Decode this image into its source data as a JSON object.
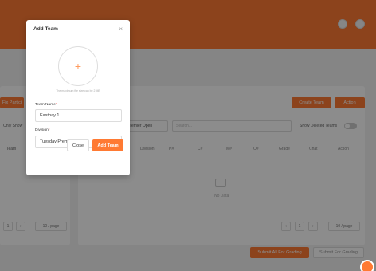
{
  "modal": {
    "title": "Add Team",
    "close_glyph": "×",
    "upload_plus": "+",
    "upload_hint": "The maximum file size can be 2 MB",
    "team_name_label": "Team Name",
    "team_name_value": "Eastbay 1",
    "division_label": "Division",
    "division_value": "Tuesday Premier Open",
    "required_mark": "*",
    "close_button": "Close",
    "add_button": "Add Team"
  },
  "background": {
    "left_button": "Fix Partici",
    "left_only_show": "Only Show",
    "left_team_header": "Team",
    "create_team_button": "Create Team",
    "action_button": "Action",
    "division_filter": "Premier Open",
    "search_placeholder": "Search...",
    "show_deleted_label": "Show Deleted Teams",
    "columns": [
      "Division",
      "P#",
      "C#",
      "M#",
      "O#",
      "Grade",
      "Chat",
      "Action"
    ],
    "empty_text": "No Data",
    "left_page": "1",
    "left_per_page": "10 / page",
    "right_page": "1",
    "right_per_page": "10 / page",
    "submit_all_button": "Submit All For Grading",
    "submit_button": "Submit For Grading"
  },
  "icons": [
    "plus-icon",
    "close-icon",
    "chevron-down-icon",
    "user-icon",
    "team-icon",
    "chat-icon",
    "empty-box-icon"
  ],
  "colors": {
    "accent": "#ff7a33"
  }
}
